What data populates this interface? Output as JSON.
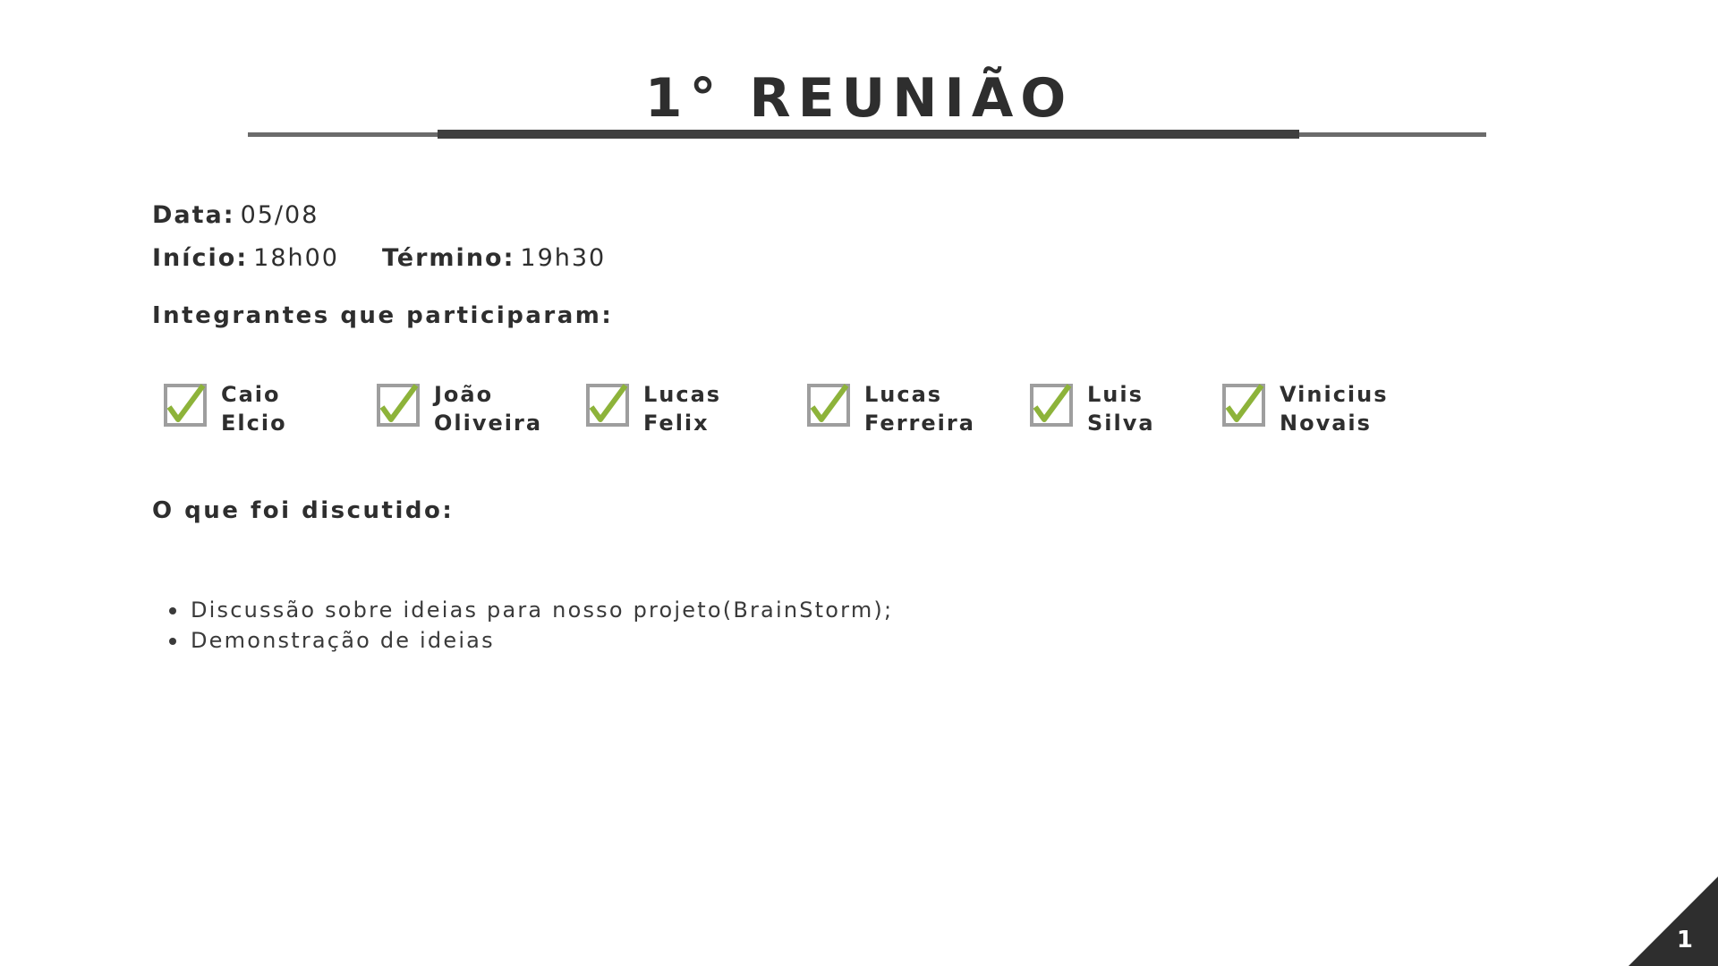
{
  "title": "1° REUNIÃO",
  "date": {
    "label": "Data:",
    "value": "05/08"
  },
  "start": {
    "label": "Início:",
    "value": "18h00"
  },
  "end": {
    "label": "Término:",
    "value": "19h30"
  },
  "members_heading": "Integrantes que participaram:",
  "members": [
    {
      "first": "Caio",
      "last": "Elcio",
      "checked": true
    },
    {
      "first": "João",
      "last": "Oliveira",
      "checked": true
    },
    {
      "first": "Lucas",
      "last": "Felix",
      "checked": true
    },
    {
      "first": "Lucas",
      "last": "Ferreira",
      "checked": true
    },
    {
      "first": "Luis",
      "last": "Silva",
      "checked": true
    },
    {
      "first": "Vinicius",
      "last": "Novais",
      "checked": true
    }
  ],
  "discussed_heading": "O que foi discutido:",
  "discussed_items": [
    "Discussão sobre ideias para nosso projeto(BrainStorm);",
    "Demonstração de ideias"
  ],
  "page_number": "1",
  "colors": {
    "text": "#2e2e2e",
    "check_green": "#8db33a",
    "box_gray": "#9e9e9e",
    "corner": "#2e2e2e"
  }
}
